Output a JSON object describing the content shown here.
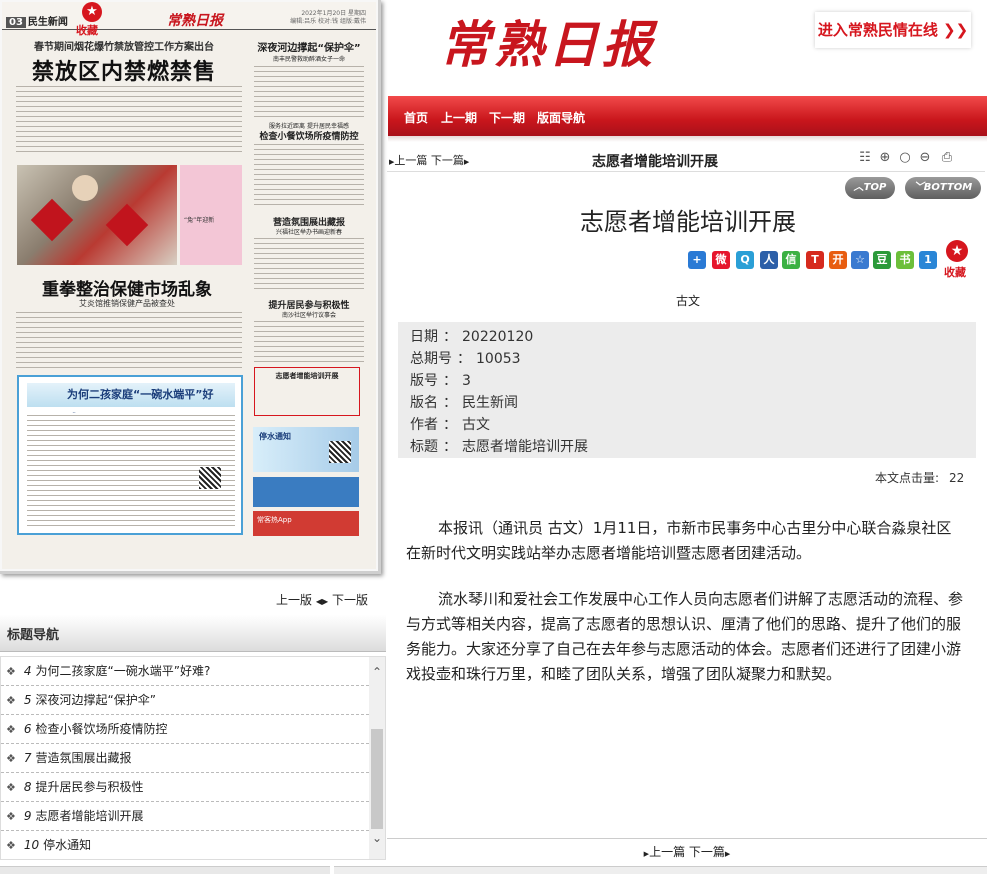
{
  "paper_page": {
    "page_tag": "03",
    "section": "民生新闻",
    "fav_label": "收藏",
    "logo": "常熟日报",
    "date_lines": [
      "2022年1月20日 星期四",
      "编辑:吕乐 校对:钱 组版:戴伟"
    ],
    "lead_subtitle": "春节期间烟花爆竹禁放管控工作方案出台",
    "lead_title": "禁放区内禁燃禁售",
    "right_top_title": "深夜河边撑起“保护伞”",
    "right_top_sub": "南丰民警救助醉酒女子一命",
    "mid_sub": "服务拉近距离 提升居民幸福感",
    "mid_title": "检查小餐饮场所疫情防控",
    "photo_caption": "“兔”年迎新",
    "h2_title": "重拳整治保健市场乱象",
    "h2_sub": "艾炎馆推销保健产品被查处",
    "market_title": "营造氛围展出藏报",
    "market_sub": "兴福社区举办书画迎新春",
    "resident_title": "提升居民参与积极性",
    "resident_sub": "南沙社区举行议事会",
    "box_title": "为何二孩家庭“一碗水端平”好难？",
    "highlight_title": "志愿者增能培训开展",
    "water_ad": "停水通知",
    "app_ad": "常客热App"
  },
  "page_nav": {
    "prev": "上一版",
    "next": "下一版"
  },
  "title_nav": {
    "header": "标题导航",
    "items": [
      {
        "idx": "4",
        "label": "为何二孩家庭“一碗水端平”好难?"
      },
      {
        "idx": "5",
        "label": "深夜河边撑起“保护伞”"
      },
      {
        "idx": "6",
        "label": "检查小餐饮场所疫情防控"
      },
      {
        "idx": "7",
        "label": "营造氛围展出藏报"
      },
      {
        "idx": "8",
        "label": "提升居民参与积极性"
      },
      {
        "idx": "9",
        "label": "志愿者增能培训开展"
      },
      {
        "idx": "10",
        "label": "停水通知"
      }
    ]
  },
  "site": {
    "logo": "常熟日报",
    "enter_link": "进入常熟民情在线 ❯❯",
    "nav": [
      "首页",
      "上一期",
      "下一期",
      "版面导航"
    ]
  },
  "article_bar": {
    "prev": "上一篇",
    "next": "下一篇",
    "title": "志愿者增能培训开展"
  },
  "buttons": {
    "top": "TOP",
    "bottom": "BOTTOM"
  },
  "article": {
    "title": "志愿者增能培训开展",
    "fav_label": "收藏",
    "author": "古文",
    "meta": [
      {
        "k": "日期",
        "v": "20220120"
      },
      {
        "k": "总期号",
        "v": "10053"
      },
      {
        "k": "版号",
        "v": "3"
      },
      {
        "k": "版名",
        "v": "民生新闻"
      },
      {
        "k": "作者",
        "v": "古文"
      },
      {
        "k": "标题",
        "v": "志愿者增能培训开展"
      }
    ],
    "hits_label": "本文点击量:",
    "hits_value": "22",
    "paragraphs": [
      "本报讯（通讯员 古文）1月11日，市新市民事务中心古里分中心联合淼泉社区在新时代文明实践站举办志愿者增能培训暨志愿者团建活动。",
      "流水琴川和爱社会工作发展中心工作人员向志愿者们讲解了志愿活动的流程、参与方式等相关内容，提高了志愿者的思想认识、厘清了他们的思路、提升了他们的服务能力。大家还分享了自己在去年参与志愿活动的体会。志愿者们还进行了团建小游戏投壶和珠行万里，和睦了团队关系，增强了团队凝聚力和默契。"
    ]
  },
  "bottom_nav": {
    "prev": "上一篇",
    "next": "下一篇"
  },
  "colors": {
    "brand_red": "#c8161e",
    "nav_red": "#d6161e",
    "meta_bg": "#ececec"
  }
}
